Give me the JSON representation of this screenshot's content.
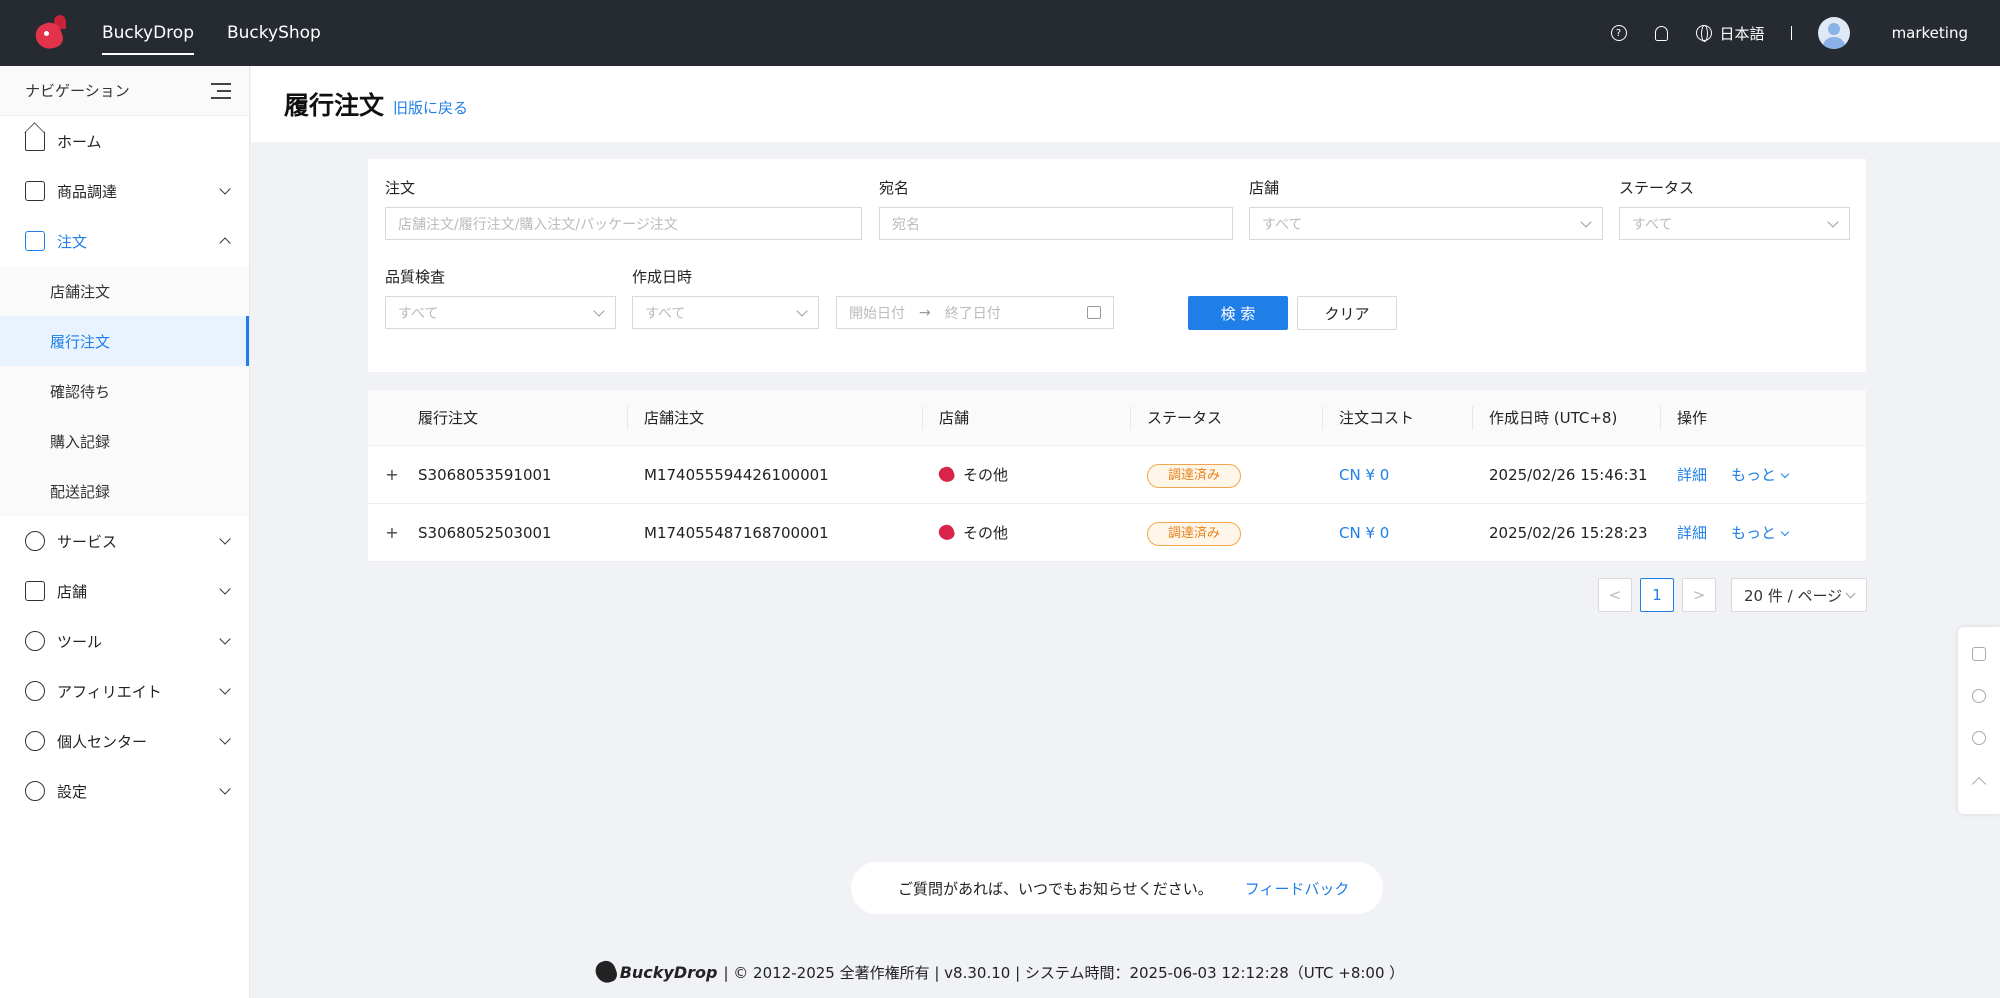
{
  "topbar": {
    "nav": [
      "BuckyDrop",
      "BuckyShop"
    ],
    "language": "日本語",
    "username": "marketing",
    "help_icon": "question-circle-icon",
    "bell_icon": "bell-icon",
    "globe_icon": "globe-icon"
  },
  "sidebar": {
    "header": "ナビゲーション",
    "items": {
      "home": "ホーム",
      "sourcing": "商品調達",
      "order": "注文",
      "service": "サービス",
      "store": "店舗",
      "tools": "ツール",
      "affiliate": "アフィリエイト",
      "personal": "個人センター",
      "settings": "設定"
    },
    "order_sub": [
      "店舗注文",
      "履行注文",
      "確認待ち",
      "購入記録",
      "配送記録"
    ]
  },
  "page": {
    "title": "履行注文",
    "back_link": "旧版に戻る"
  },
  "filters": {
    "order_label": "注文",
    "order_placeholder": "店舗注文/履行注文/購入注文/パッケージ注文",
    "recipient_label": "宛名",
    "recipient_placeholder": "宛名",
    "store_label": "店舗",
    "store_value": "すべて",
    "status_label": "ステータス",
    "status_value": "すべて",
    "qc_label": "品質検査",
    "qc_value": "すべて",
    "created_label": "作成日時",
    "created_value": "すべて",
    "start_date": "開始日付",
    "date_arrow": "→",
    "end_date": "終了日付",
    "search_button": "検 索",
    "clear_button": "クリア"
  },
  "table": {
    "columns": [
      "履行注文",
      "店舗注文",
      "店舗",
      "ステータス",
      "注文コスト",
      "作成日時 (UTC+8)",
      "操作"
    ],
    "rows": [
      {
        "expand": "+",
        "fulfillment": "S3068053591001",
        "store_order": "M174055594426100001",
        "store": "その他",
        "status": "調達済み",
        "cost": "CN ¥ 0",
        "created": "2025/02/26 15:46:31",
        "detail": "詳細",
        "more": "もっと"
      },
      {
        "expand": "+",
        "fulfillment": "S3068052503001",
        "store_order": "M174055487168700001",
        "store": "その他",
        "status": "調達済み",
        "cost": "CN ¥ 0",
        "created": "2025/02/26 15:28:23",
        "detail": "詳細",
        "more": "もっと"
      }
    ]
  },
  "pagination": {
    "prev": "<",
    "current": "1",
    "next": ">",
    "page_size": "20 件 / ページ"
  },
  "feedback": {
    "question": "ご質問があれば、いつでもお知らせください。",
    "link": "フィードバック"
  },
  "footer": {
    "brand": "BuckyDrop",
    "text": "| © 2012-2025 全著作権所有 | v8.30.10 | システム時間：2025-06-03 12:12:28（UTC +8:00 ）"
  },
  "colors": {
    "accent": "#1f7ee8",
    "topbar": "#262a31",
    "status_badge": "#e8811a"
  }
}
